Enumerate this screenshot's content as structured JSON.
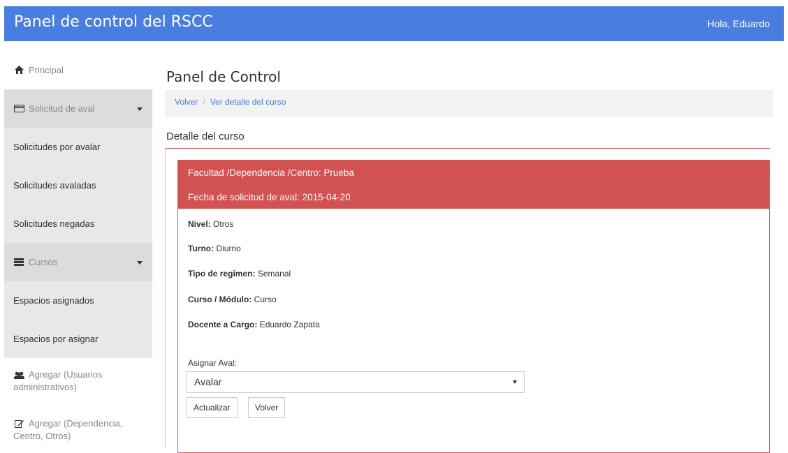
{
  "header": {
    "title": "Panel de control del RSCC",
    "greeting": "Hola, Eduardo"
  },
  "sidebar": {
    "items": [
      {
        "label": "Principal",
        "icon": "home-icon"
      },
      {
        "label": "Solicitud de aval",
        "icon": "credit-card-icon"
      },
      {
        "label": "Solicitudes por avalar"
      },
      {
        "label": "Solicitudes avaladas"
      },
      {
        "label": "Solicitudes negadas"
      },
      {
        "label": "Cursos",
        "icon": "list-icon"
      },
      {
        "label": "Espacios asignados"
      },
      {
        "label": "Espacios por asignar"
      },
      {
        "label": "Agregar (Usuarios administrativos)",
        "icon": "users-icon"
      },
      {
        "label": "Agregar (Dependencia, Centro, Otros)",
        "icon": "edit-icon"
      }
    ]
  },
  "main": {
    "title": "Panel de Control",
    "breadcrumb": {
      "back": "Volver",
      "separator": "/",
      "current": "Ver detalle del curso"
    },
    "section_title": "Detalle del curso",
    "panel": {
      "faculty": "Facultad /Dependencia /Centro: Prueba",
      "request_date": "Fecha de solicitud de aval: 2015-04-20",
      "fields": [
        {
          "label": "Nivel:",
          "value": "Otros"
        },
        {
          "label": "Turno:",
          "value": "Diurno"
        },
        {
          "label": "Tipo de regimen:",
          "value": "Semanal"
        },
        {
          "label": "Curso / Módulo:",
          "value": "Curso"
        },
        {
          "label": "Docente a Cargo:",
          "value": "Eduardo Zapata"
        }
      ]
    },
    "form": {
      "label": "Asignar Aval:",
      "selected": "Avalar",
      "update_button": "Actualizar",
      "back_button": "Volver"
    }
  },
  "colors": {
    "header": "#4a7de0",
    "panel_head": "#d25152",
    "link": "#4a7de0"
  }
}
